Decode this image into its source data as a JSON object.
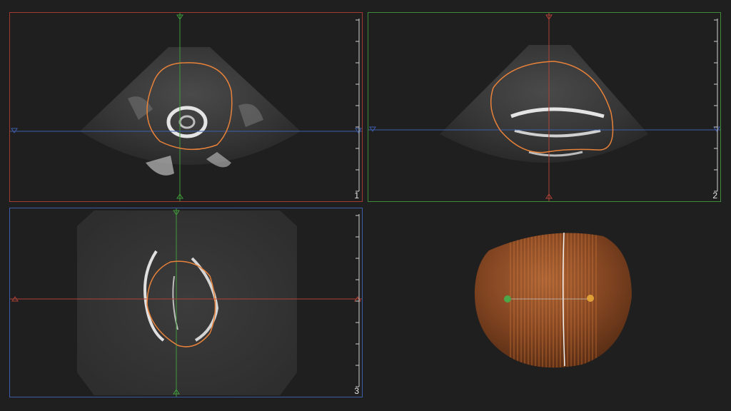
{
  "viewer": {
    "panes": [
      {
        "id": "axial-a",
        "number": "1",
        "border_color": "#a13a30"
      },
      {
        "id": "axial-b",
        "number": "2",
        "border_color": "#3e8c3a"
      },
      {
        "id": "axial-c",
        "number": "3",
        "border_color": "#3c5ca8"
      },
      {
        "id": "render-3d",
        "number": ""
      }
    ],
    "colors": {
      "red_crosshair": "#b04236",
      "green_crosshair": "#3f9a3a",
      "blue_crosshair": "#3c5ca8",
      "contour": "#e8823a",
      "volume_fill": "#9a4a1c",
      "ultrasound_bg": "#343434"
    }
  }
}
